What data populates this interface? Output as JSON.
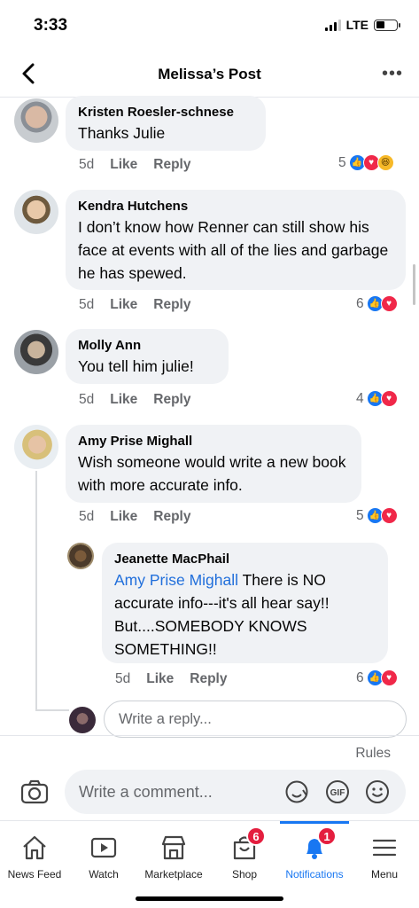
{
  "status": {
    "time": "3:33",
    "network": "LTE"
  },
  "header": {
    "title": "Melissa’s Post",
    "back_icon": "chevron-left-icon",
    "more_icon": "more-icon"
  },
  "comments": [
    {
      "name": "Kristen Roesler-schnese",
      "text": "Thanks Julie",
      "time": "5d",
      "like": "Like",
      "reply": "Reply",
      "reaction_count": "5",
      "reactions": [
        "like",
        "love",
        "haha"
      ]
    },
    {
      "name": "Kendra Hutchens",
      "text": "I don’t know how Renner can still show his face at events with all of the lies and garbage he has spewed.",
      "time": "5d",
      "like": "Like",
      "reply": "Reply",
      "reaction_count": "6",
      "reactions": [
        "like",
        "love"
      ]
    },
    {
      "name": "Molly Ann",
      "text": "You tell him julie!",
      "time": "5d",
      "like": "Like",
      "reply": "Reply",
      "reaction_count": "4",
      "reactions": [
        "like",
        "love"
      ]
    },
    {
      "name": "Amy Prise Mighall",
      "text": "Wish someone would write a new book with more accurate info.",
      "time": "5d",
      "like": "Like",
      "reply": "Reply",
      "reaction_count": "5",
      "reactions": [
        "like",
        "love"
      ]
    }
  ],
  "reply": {
    "name": "Jeanette MacPhail",
    "mention": "Amy Prise Mighall",
    "text": " There is NO accurate info---it's all hear say!! But....SOMEBODY KNOWS SOMETHING!!",
    "time": "5d",
    "like": "Like",
    "reply": "Reply",
    "reaction_count": "6",
    "reactions": [
      "like",
      "love"
    ]
  },
  "reply_input": {
    "placeholder": "Write a reply..."
  },
  "rules_label": "Rules",
  "composer": {
    "placeholder": "Write a comment...",
    "icons": [
      "camera-icon",
      "sticker-icon",
      "gif-icon",
      "emoji-icon"
    ],
    "gif_label": "GIF"
  },
  "tabs": [
    {
      "label": "News Feed",
      "icon": "home-icon"
    },
    {
      "label": "Watch",
      "icon": "watch-icon"
    },
    {
      "label": "Marketplace",
      "icon": "marketplace-icon"
    },
    {
      "label": "Shop",
      "icon": "shop-icon",
      "badge": "6"
    },
    {
      "label": "Notifications",
      "icon": "bell-icon",
      "badge": "1",
      "active": true
    },
    {
      "label": "Menu",
      "icon": "menu-icon"
    }
  ],
  "colors": {
    "accent": "#1877f2",
    "bubble": "#f0f2f5",
    "badge": "#e41e3f",
    "secondary_text": "#65676b"
  }
}
